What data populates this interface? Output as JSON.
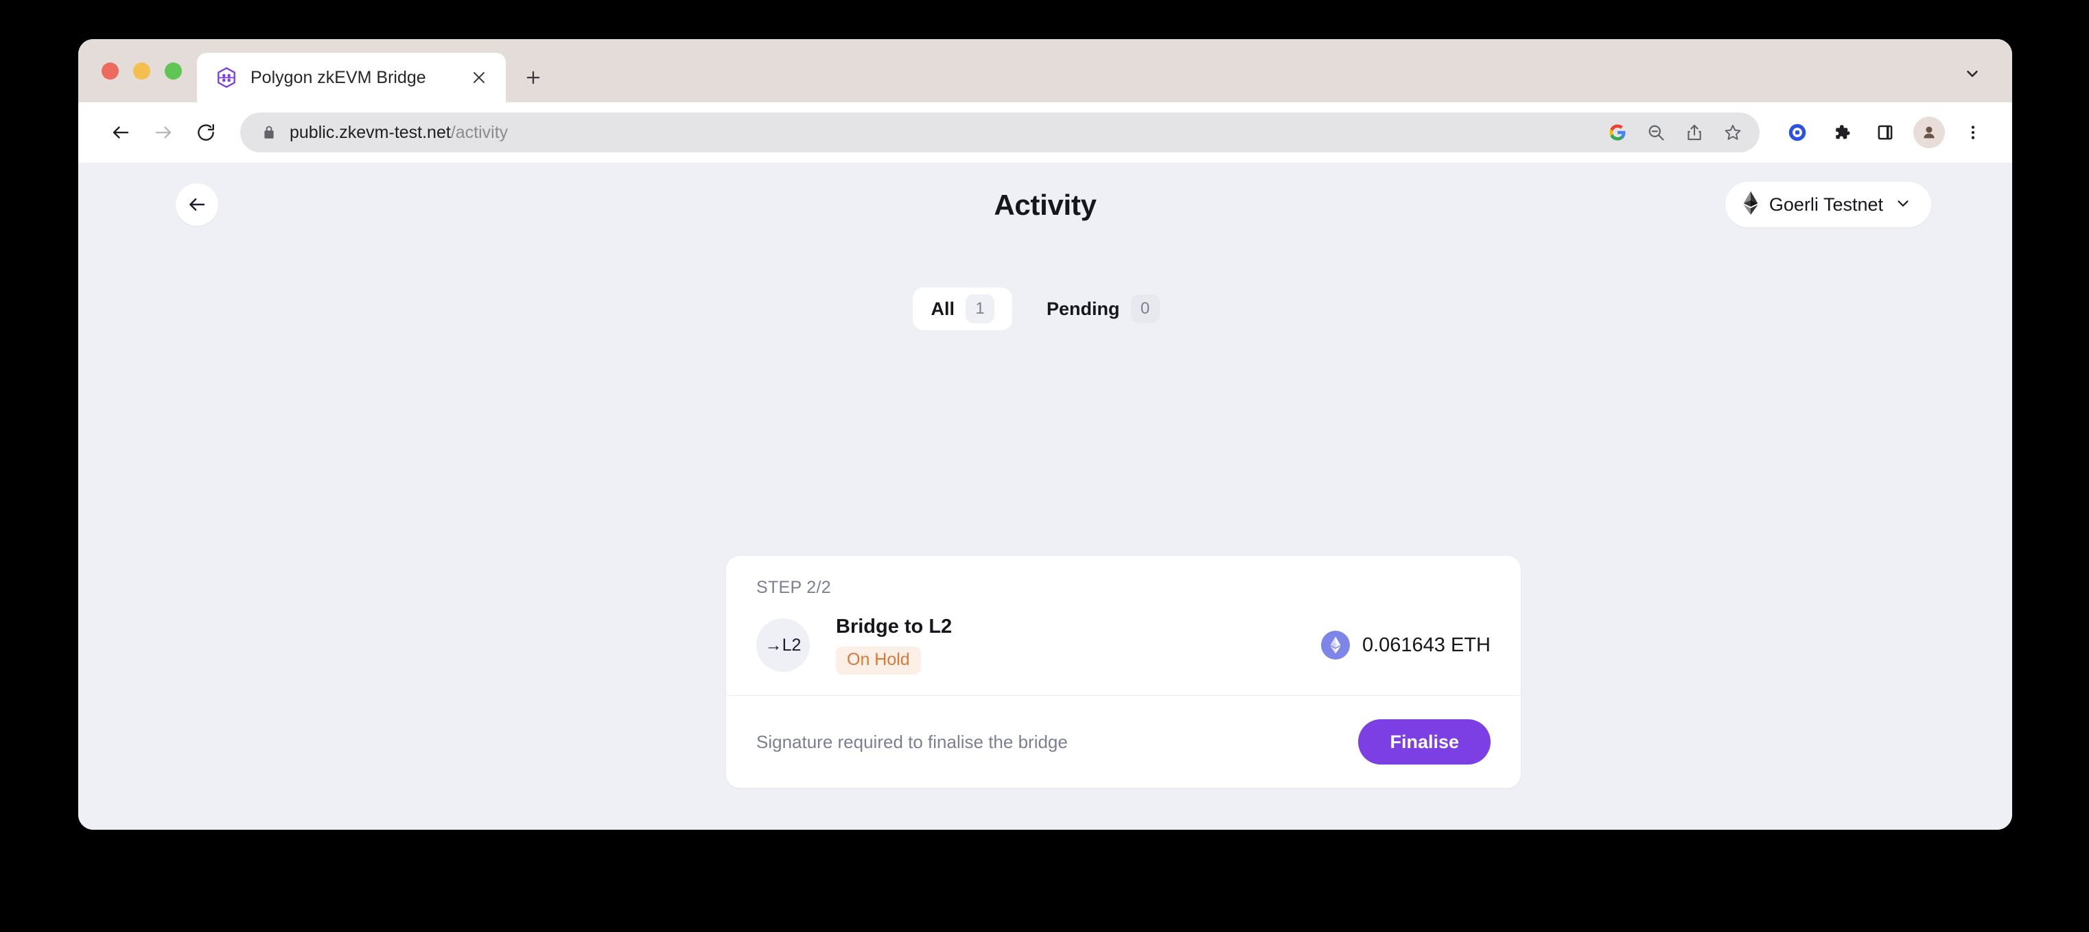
{
  "browser": {
    "tab": {
      "title": "Polygon zkEVM Bridge",
      "favicon_name": "polygon-logo-icon",
      "close_label": "×"
    },
    "new_tab_label": "+",
    "traffic_lights": [
      "close",
      "minimize",
      "maximize"
    ],
    "toolbar": {
      "back_label": "←",
      "forward_label": "→",
      "reload_label": "⟳",
      "url_domain": "public.zkevm-test.net",
      "url_path": "/activity",
      "omnibox_icons": [
        "google-lens-icon",
        "zoom-out-icon",
        "share-icon",
        "bookmark-star-icon"
      ],
      "right_icons": [
        "target-extension-icon",
        "extensions-puzzle-icon",
        "side-panel-icon",
        "profile-avatar",
        "chrome-menu-icon"
      ]
    },
    "tab_search_label": "⌄"
  },
  "page": {
    "back_button_label": "←",
    "title": "Activity",
    "network": {
      "name": "Goerli Testnet",
      "icon_name": "ethereum-diamond-icon",
      "chevron_label": "⌄"
    },
    "filters": [
      {
        "label": "All",
        "count": "1",
        "active": true
      },
      {
        "label": "Pending",
        "count": "0",
        "active": false
      }
    ],
    "activity": {
      "step": "STEP 2/2",
      "direction_badge": "→L2",
      "transaction_title": "Bridge to L2",
      "status": "On Hold",
      "amount": "0.061643 ETH",
      "token_icon_name": "ethereum-token-icon",
      "footer_note": "Signature required to finalise the bridge",
      "action_label": "Finalise"
    }
  },
  "colors": {
    "page_background": "#eef0f5",
    "card_background": "#ffffff",
    "accent_purple": "#7b3fe4",
    "status_orange_text": "#d8793a",
    "status_orange_background": "#fcefe5",
    "token_badge": "#7d86e8",
    "titlebar": "#e4dcd9"
  }
}
